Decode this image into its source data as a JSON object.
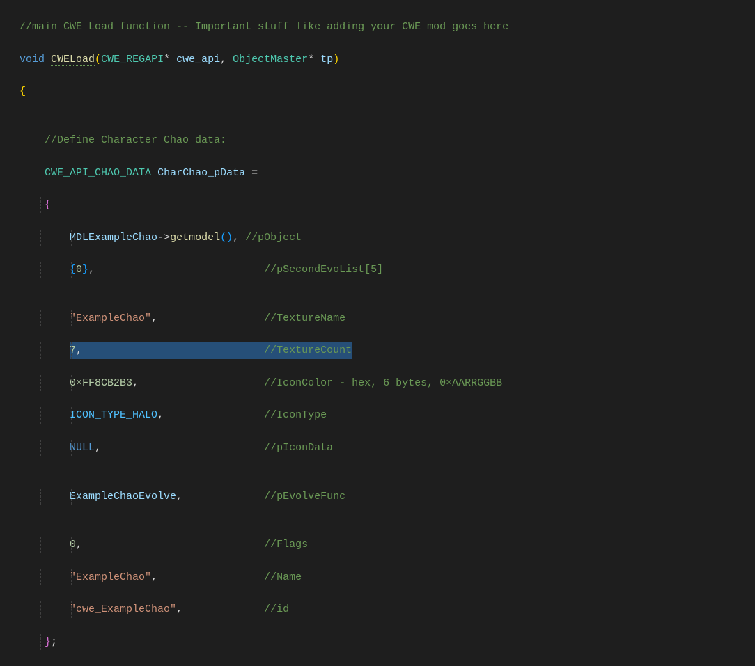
{
  "code": {
    "c1": "//main CWE Load function -- Important stuff like adding your CWE mod goes here",
    "kw_void": "void",
    "fn_name": "CWELoad",
    "type1": "CWE_REGAPI",
    "star": "*",
    "p1": "cwe_api",
    "comma": ",",
    "type2": "ObjectMaster",
    "p2": "tp",
    "c2": "//Define Character Chao data:",
    "type3": "CWE_API_CHAO_DATA",
    "var1": "CharChao_pData",
    "eq": " =",
    "ident1": "MDLExampleChao",
    "arrow": "->",
    "method1": "getmodel",
    "c_pobj": "//pObject",
    "zero_init": "0",
    "c_evolist": "//pSecondEvoList[5]",
    "str1": "\"ExampleChao\"",
    "c_texname": "//TextureName",
    "num7": "7",
    "c_texcount": "//TextureCount",
    "hex1": "0×FF8CB2B3",
    "c_iconcolor": "//IconColor - hex, 6 bytes, 0×AARRGGBB",
    "const1": "ICON_TYPE_HALO",
    "c_icontype": "//IconType",
    "null1": "NULL",
    "c_picondata": "//pIconData",
    "ident2": "ExampleChaoEvolve",
    "c_pevolve": "//pEvolveFunc",
    "num0": "0",
    "c_flags": "//Flags",
    "str2": "\"ExampleChao\"",
    "c_name": "//Name",
    "str3": "\"cwe_ExampleChao\"",
    "c_id": "//id"
  }
}
